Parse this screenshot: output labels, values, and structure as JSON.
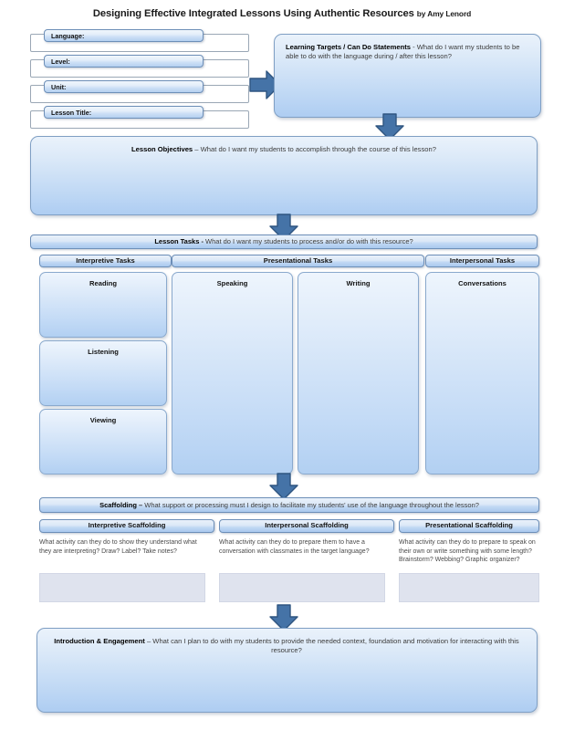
{
  "title": {
    "main": "Designing Effective Integrated Lessons Using Authentic Resources",
    "author": "by Amy Lenord"
  },
  "form_fields": [
    {
      "label": "Language:",
      "value": ""
    },
    {
      "label": "Level:",
      "value": ""
    },
    {
      "label": "Unit:",
      "value": ""
    },
    {
      "label": "Lesson Title:",
      "value": ""
    }
  ],
  "learning_targets": {
    "heading": "Learning Targets / Can Do Statements",
    "separator": " - ",
    "question": "What do I want my students to be able to do with the language during / after this lesson?"
  },
  "lesson_objectives": {
    "heading": "Lesson Objectives",
    "separator": " – ",
    "question": "What do I want my students to accomplish through the course of this lesson?"
  },
  "lesson_tasks": {
    "heading": "Lesson Tasks",
    "separator": " - ",
    "question": "What do I want my students to process and/or do with this resource?",
    "columns": [
      {
        "header": "Interpretive Tasks",
        "boxes": [
          "Reading",
          "Listening",
          "Viewing"
        ]
      },
      {
        "header": "Presentational Tasks",
        "boxes": [
          "Speaking",
          "Writing"
        ]
      },
      {
        "header": "Interpersonal Tasks",
        "boxes": [
          "Conversations"
        ]
      }
    ]
  },
  "scaffolding": {
    "heading": "Scaffolding",
    "separator": " – ",
    "question": "What support or processing must I design to facilitate my students' use of the language throughout the lesson?",
    "columns": [
      {
        "header": "Interpretive Scaffolding",
        "description": "What activity can they do to show they understand what they are interpreting? Draw? Label? Take notes?"
      },
      {
        "header": "Interpersonal Scaffolding",
        "description": "What activity can they do to prepare them to have a conversation with classmates in the target language?"
      },
      {
        "header": "Presentational Scaffolding",
        "description": "What activity can they do to prepare to speak on their own or write something with some length? Brainstorm? Webbing? Graphic organizer?"
      }
    ]
  },
  "introduction": {
    "heading": "Introduction & Engagement",
    "separator": " – ",
    "question": "What can I plan to do with my students to provide the needed context, foundation and motivation for interacting with this resource?"
  },
  "colors": {
    "panel_border": "#7f9fc4",
    "panel_fill_top": "#eaf2fb",
    "panel_fill_bottom": "#aecdf2",
    "bar_border": "#6d8fb8",
    "arrow_fill": "#4573a7",
    "arrow_stroke": "#2f5580",
    "scaffold_fill": "#dfe3ee",
    "text": "#3b3b3b"
  },
  "icons": {
    "arrow_right": "arrow-right-icon",
    "arrow_down": "arrow-down-icon"
  }
}
